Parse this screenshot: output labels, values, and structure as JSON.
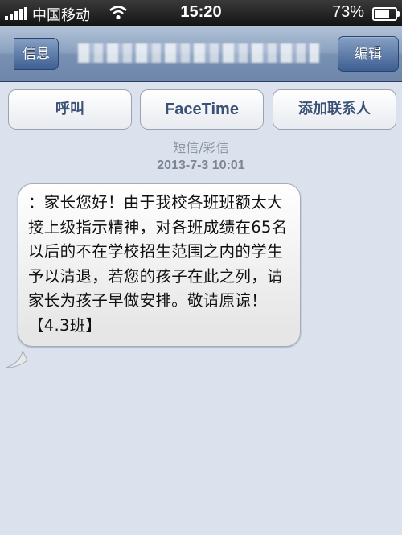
{
  "status_bar": {
    "carrier": "中国移动",
    "time": "15:20",
    "battery_percent_text": "73%",
    "battery_level": 0.73
  },
  "nav_bar": {
    "back_label": "信息",
    "edit_label": "编辑"
  },
  "actions": {
    "call_label": "呼叫",
    "facetime_label": "FaceTime",
    "add_contact_label": "添加联系人"
  },
  "conversation": {
    "type_label": "短信/彩信",
    "timestamp": "2013-7-3 10:01",
    "message": "：家长您好！由于我校各班班额太大接上级指示精神，对各班成绩在65名以后的不在学校招生范围之内的学生予以清退，若您的孩子在此之列，请家长为孩子早做安排。敬请原谅！【4.3班】"
  },
  "colors": {
    "nav_gradient_top": "#b3c3d8",
    "nav_gradient_bottom": "#6d86aa",
    "background": "#dbe2ed",
    "button_text": "#3b5176"
  }
}
